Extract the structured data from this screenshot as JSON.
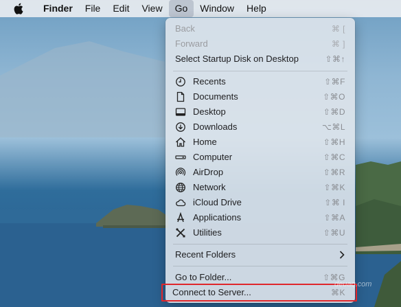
{
  "menubar": {
    "app_name": "Finder",
    "items": [
      "File",
      "Edit",
      "View",
      "Go",
      "Window",
      "Help"
    ]
  },
  "go_menu": {
    "back": {
      "label": "Back",
      "shortcut": "⌘ ["
    },
    "forward": {
      "label": "Forward",
      "shortcut": "⌘ ]"
    },
    "startup": {
      "label": "Select Startup Disk on Desktop",
      "shortcut": "⇧⌘↑"
    },
    "recents": {
      "label": "Recents",
      "shortcut": "⇧⌘F",
      "icon": "clock-icon"
    },
    "documents": {
      "label": "Documents",
      "shortcut": "⇧⌘O",
      "icon": "document-icon"
    },
    "desktop": {
      "label": "Desktop",
      "shortcut": "⇧⌘D",
      "icon": "desktop-icon"
    },
    "downloads": {
      "label": "Downloads",
      "shortcut": "⌥⌘L",
      "icon": "download-icon"
    },
    "home": {
      "label": "Home",
      "shortcut": "⇧⌘H",
      "icon": "home-icon"
    },
    "computer": {
      "label": "Computer",
      "shortcut": "⇧⌘C",
      "icon": "computer-icon"
    },
    "airdrop": {
      "label": "AirDrop",
      "shortcut": "⇧⌘R",
      "icon": "airdrop-icon"
    },
    "network": {
      "label": "Network",
      "shortcut": "⇧⌘K",
      "icon": "globe-icon"
    },
    "icloud": {
      "label": "iCloud Drive",
      "shortcut": "⇧⌘ I",
      "icon": "cloud-icon"
    },
    "applications": {
      "label": "Applications",
      "shortcut": "⇧⌘A",
      "icon": "applications-icon"
    },
    "utilities": {
      "label": "Utilities",
      "shortcut": "⇧⌘U",
      "icon": "tools-icon"
    },
    "recent_folders": {
      "label": "Recent Folders"
    },
    "goto_folder": {
      "label": "Go to Folder...",
      "shortcut": "⇧⌘G"
    },
    "connect_server": {
      "label": "Connect to Server...",
      "shortcut": "⌘K"
    }
  },
  "watermark": "deuaq.com",
  "colors": {
    "highlight_border": "#e0262b"
  }
}
